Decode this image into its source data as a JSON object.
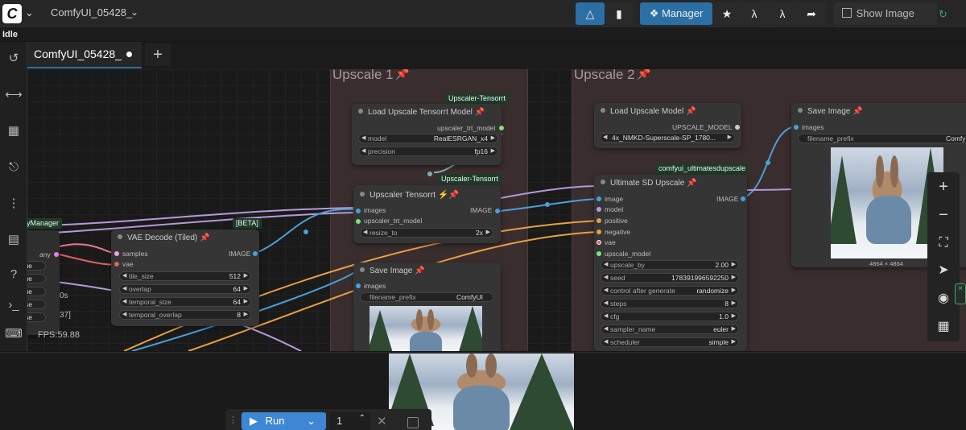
{
  "topbar": {
    "logo_letter": "C",
    "workflow_name": "ComfyUI_05428_",
    "manager_label": "Manager",
    "show_image_feed_label": "Show Image Feed"
  },
  "status": {
    "text": "Idle"
  },
  "tabs": [
    {
      "label": "ComfyUI_05428_",
      "modified": true
    }
  ],
  "sidebar": {
    "icons": [
      "history-icon",
      "nodes-icon",
      "models-icon",
      "workflows-icon",
      "node-tree-icon",
      "templates-icon",
      "help-icon",
      "terminal-icon",
      "keyboard-icon"
    ]
  },
  "groups": [
    {
      "title": "Upscale 1"
    },
    {
      "title": "Upscale 2"
    }
  ],
  "left_partial_node": {
    "title_fragment": "yManager",
    "slot_any": "any",
    "toggles": [
      "true",
      "true",
      "true",
      "alse",
      "alse"
    ],
    "fragment_s": "0s",
    "fragment_37": "37]"
  },
  "nodes": {
    "vae_decode": {
      "title": "VAE Decode (Tiled)",
      "badge": "[BETA]",
      "inputs": [
        "samples",
        "vae"
      ],
      "output": "IMAGE",
      "widgets": [
        {
          "label": "tile_size",
          "value": "512"
        },
        {
          "label": "overlap",
          "value": "64"
        },
        {
          "label": "temporal_size",
          "value": "64"
        },
        {
          "label": "temporal_overlap",
          "value": "8"
        }
      ]
    },
    "load_trt": {
      "title": "Load Upscale Tensorrt Model",
      "badge": "Upscaler-Tensorrt",
      "output": "upscaler_trt_model",
      "widgets": [
        {
          "label": "model",
          "value": "RealESRGAN_x4"
        },
        {
          "label": "precision",
          "value": "fp16"
        }
      ]
    },
    "upscaler_trt": {
      "title": "Upscaler Tensorrt",
      "badge": "Upscaler-Tensorrt",
      "inputs": [
        "images",
        "upscaler_trt_model"
      ],
      "output": "IMAGE",
      "widgets": [
        {
          "label": "resize_to",
          "value": "2x"
        }
      ]
    },
    "save_image_1": {
      "title": "Save Image",
      "inputs": [
        "images"
      ],
      "widgets": [
        {
          "label": "filename_prefix",
          "value": "ComfyUI"
        }
      ]
    },
    "load_upscale": {
      "title": "Load Upscale Model",
      "output": "UPSCALE_MODEL",
      "widgets": [
        {
          "label": "",
          "value": "4x_NMKD-Superscale-SP_1780..."
        }
      ]
    },
    "ultimate_sd": {
      "title": "Ultimate SD Upscale",
      "badge": "comfyui_ultimatesdupscale",
      "inputs": [
        "image",
        "model",
        "positive",
        "negative",
        "vae",
        "upscale_model"
      ],
      "output": "IMAGE",
      "widgets": [
        {
          "label": "upscale_by",
          "value": "2.00"
        },
        {
          "label": "seed",
          "value": "178391996592250"
        },
        {
          "label": "control after generate",
          "value": "randomize"
        },
        {
          "label": "steps",
          "value": "8"
        },
        {
          "label": "cfg",
          "value": "1.0"
        },
        {
          "label": "sampler_name",
          "value": "euler"
        },
        {
          "label": "scheduler",
          "value": "simple"
        }
      ]
    },
    "save_image_2": {
      "title": "Save Image",
      "inputs": [
        "images"
      ],
      "widgets": [
        {
          "label": "filename_prefix",
          "value": "ComfyUI"
        }
      ],
      "image_size": "4864 × 4864"
    }
  },
  "fps": "FPS:59.88",
  "run": {
    "label": "Run",
    "count": "1"
  },
  "colors": {
    "accent": "#2c6fa5",
    "group_bg": "#3a2d2d",
    "node_bg": "#353535",
    "badge_bg": "#1f3a2a",
    "link_orange": "#e8a043",
    "link_purple": "#b49ad8",
    "link_blue": "#4a9fd8",
    "run_blue": "#3f86d4"
  }
}
